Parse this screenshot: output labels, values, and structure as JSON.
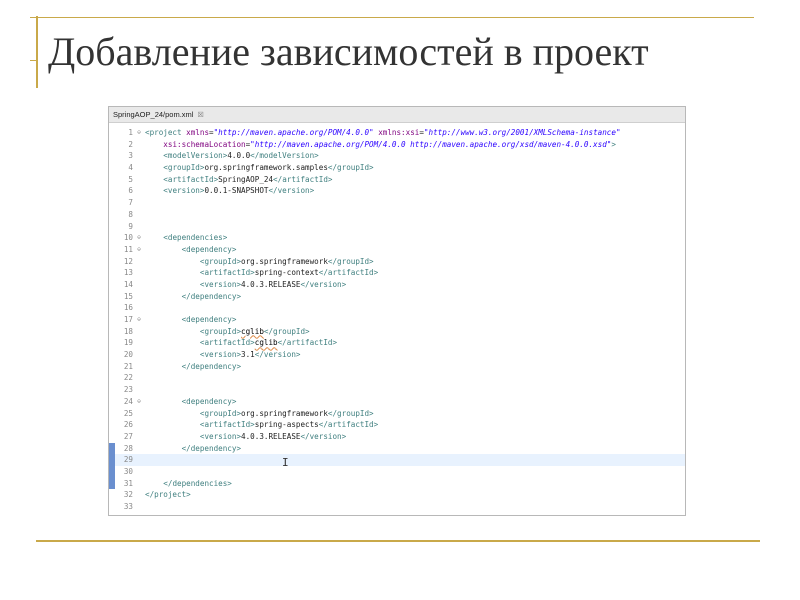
{
  "slide": {
    "title": "Добавление зависимостей в проект"
  },
  "editor": {
    "tab_label": "SpringAOP_24/pom.xml",
    "tab_close": "☒",
    "lines": [
      {
        "n": "1",
        "fold": "⊖",
        "parts": [
          [
            "tag",
            "<project "
          ],
          [
            "attr",
            "xmlns"
          ],
          [
            "txt",
            "="
          ],
          [
            "val",
            "\"http://maven.apache.org/POM/4.0.0\""
          ],
          [
            "txt",
            " "
          ],
          [
            "attr",
            "xmlns:xsi"
          ],
          [
            "txt",
            "="
          ],
          [
            "val",
            "\"http://www.w3.org/2001/XMLSchema-instance\""
          ]
        ]
      },
      {
        "n": "2",
        "parts": [
          [
            "txt",
            "    "
          ],
          [
            "attr",
            "xsi:schemaLocation"
          ],
          [
            "txt",
            "="
          ],
          [
            "val",
            "\"http://maven.apache.org/POM/4.0.0 http://maven.apache.org/xsd/maven-4.0.0.xsd\""
          ],
          [
            "tag",
            ">"
          ]
        ]
      },
      {
        "n": "3",
        "parts": [
          [
            "txt",
            "    "
          ],
          [
            "tag",
            "<modelVersion>"
          ],
          [
            "txt",
            "4.0.0"
          ],
          [
            "tag",
            "</modelVersion>"
          ]
        ]
      },
      {
        "n": "4",
        "parts": [
          [
            "txt",
            "    "
          ],
          [
            "tag",
            "<groupId>"
          ],
          [
            "txt",
            "org.springframework.samples"
          ],
          [
            "tag",
            "</groupId>"
          ]
        ]
      },
      {
        "n": "5",
        "parts": [
          [
            "txt",
            "    "
          ],
          [
            "tag",
            "<artifactId>"
          ],
          [
            "txt",
            "SpringAOP_24"
          ],
          [
            "tag",
            "</artifactId>"
          ]
        ]
      },
      {
        "n": "6",
        "parts": [
          [
            "txt",
            "    "
          ],
          [
            "tag",
            "<version>"
          ],
          [
            "txt",
            "0.0.1-SNAPSHOT"
          ],
          [
            "tag",
            "</version>"
          ]
        ]
      },
      {
        "n": "7",
        "parts": []
      },
      {
        "n": "8",
        "parts": []
      },
      {
        "n": "9",
        "parts": []
      },
      {
        "n": "10",
        "fold": "⊖",
        "parts": [
          [
            "txt",
            "    "
          ],
          [
            "tag",
            "<dependencies>"
          ]
        ]
      },
      {
        "n": "11",
        "fold": "⊖",
        "parts": [
          [
            "txt",
            "        "
          ],
          [
            "tag",
            "<dependency>"
          ]
        ]
      },
      {
        "n": "12",
        "parts": [
          [
            "txt",
            "            "
          ],
          [
            "tag",
            "<groupId>"
          ],
          [
            "txt",
            "org.springframework"
          ],
          [
            "tag",
            "</groupId>"
          ]
        ]
      },
      {
        "n": "13",
        "parts": [
          [
            "txt",
            "            "
          ],
          [
            "tag",
            "<artifactId>"
          ],
          [
            "txt",
            "spring-context"
          ],
          [
            "tag",
            "</artifactId>"
          ]
        ]
      },
      {
        "n": "14",
        "parts": [
          [
            "txt",
            "            "
          ],
          [
            "tag",
            "<version>"
          ],
          [
            "txt",
            "4.0.3.RELEASE"
          ],
          [
            "tag",
            "</version>"
          ]
        ]
      },
      {
        "n": "15",
        "parts": [
          [
            "txt",
            "        "
          ],
          [
            "tag",
            "</dependency>"
          ]
        ]
      },
      {
        "n": "16",
        "parts": []
      },
      {
        "n": "17",
        "fold": "⊖",
        "parts": [
          [
            "txt",
            "        "
          ],
          [
            "tag",
            "<dependency>"
          ]
        ]
      },
      {
        "n": "18",
        "parts": [
          [
            "txt",
            "            "
          ],
          [
            "tag",
            "<groupId>"
          ],
          [
            "spell",
            "cglib"
          ],
          [
            "tag",
            "</groupId>"
          ]
        ]
      },
      {
        "n": "19",
        "parts": [
          [
            "txt",
            "            "
          ],
          [
            "tag",
            "<artifactId>"
          ],
          [
            "spell",
            "cglib"
          ],
          [
            "tag",
            "</artifactId>"
          ]
        ]
      },
      {
        "n": "20",
        "parts": [
          [
            "txt",
            "            "
          ],
          [
            "tag",
            "<version>"
          ],
          [
            "txt",
            "3.1"
          ],
          [
            "tag",
            "</version>"
          ]
        ]
      },
      {
        "n": "21",
        "parts": [
          [
            "txt",
            "        "
          ],
          [
            "tag",
            "</dependency>"
          ]
        ]
      },
      {
        "n": "22",
        "parts": []
      },
      {
        "n": "23",
        "parts": []
      },
      {
        "n": "24",
        "fold": "⊖",
        "parts": [
          [
            "txt",
            "        "
          ],
          [
            "tag",
            "<dependency>"
          ]
        ]
      },
      {
        "n": "25",
        "parts": [
          [
            "txt",
            "            "
          ],
          [
            "tag",
            "<groupId>"
          ],
          [
            "txt",
            "org.springframework"
          ],
          [
            "tag",
            "</groupId>"
          ]
        ]
      },
      {
        "n": "26",
        "parts": [
          [
            "txt",
            "            "
          ],
          [
            "tag",
            "<artifactId>"
          ],
          [
            "txt",
            "spring-aspects"
          ],
          [
            "tag",
            "</artifactId>"
          ]
        ]
      },
      {
        "n": "27",
        "parts": [
          [
            "txt",
            "            "
          ],
          [
            "tag",
            "<version>"
          ],
          [
            "txt",
            "4.0.3.RELEASE"
          ],
          [
            "tag",
            "</version>"
          ]
        ]
      },
      {
        "n": "28",
        "parts": [
          [
            "txt",
            "        "
          ],
          [
            "tag",
            "</dependency>"
          ]
        ]
      },
      {
        "n": "29",
        "current": true,
        "parts": []
      },
      {
        "n": "30",
        "parts": []
      },
      {
        "n": "31",
        "parts": [
          [
            "txt",
            "    "
          ],
          [
            "tag",
            "</dependencies>"
          ]
        ]
      },
      {
        "n": "32",
        "parts": [
          [
            "tag",
            "</project>"
          ]
        ]
      },
      {
        "n": "33",
        "parts": []
      }
    ],
    "changed_lines": [
      "28",
      "29",
      "30",
      "31"
    ]
  },
  "colors": {
    "accent_gold": "#c9a94a",
    "xml_tag": "#3f7f7f",
    "xml_attr": "#7f007f",
    "xml_value": "#2a00ff",
    "current_line": "#e8f2fe"
  }
}
